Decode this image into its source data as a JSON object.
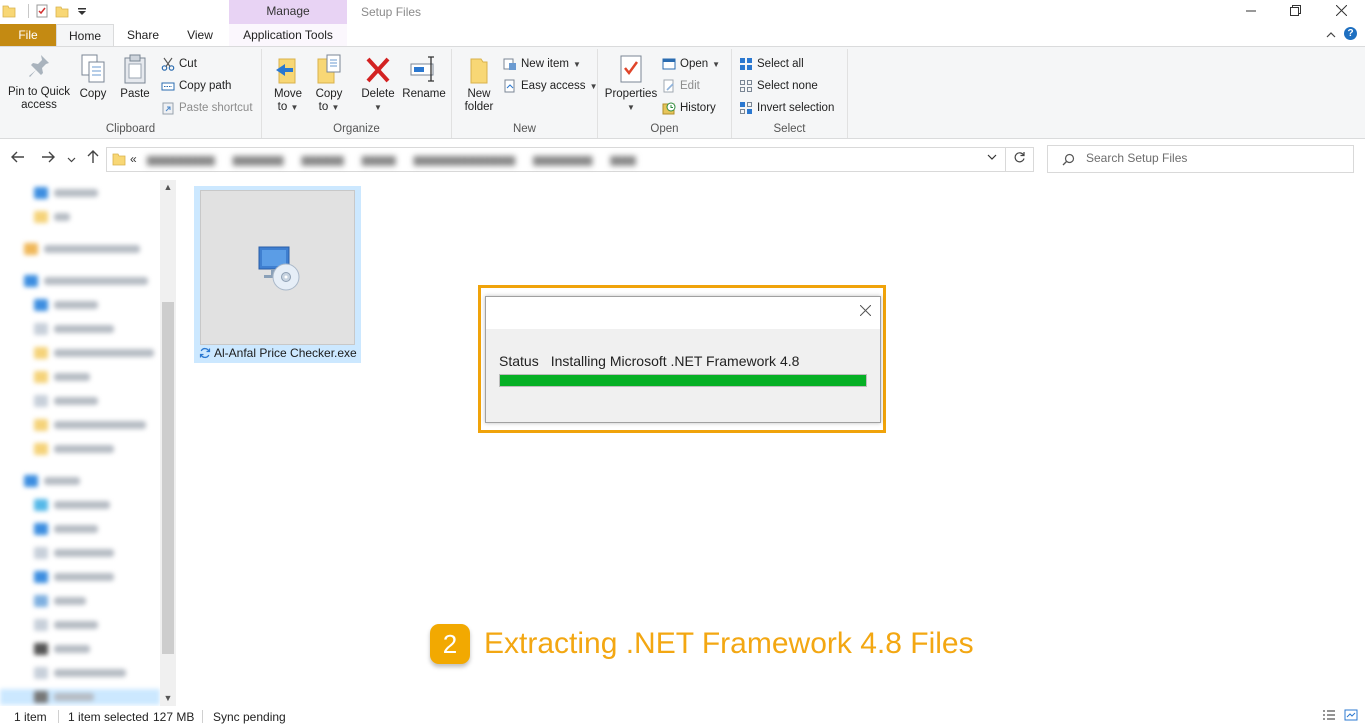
{
  "window": {
    "title": "Setup Files",
    "contextual_tab_group": "Manage",
    "controls": [
      "minimize",
      "maximize",
      "close"
    ]
  },
  "ribbon_tabs": {
    "file": "File",
    "home": "Home",
    "share": "Share",
    "view": "View",
    "application_tools": "Application Tools"
  },
  "ribbon": {
    "clipboard": {
      "label": "Clipboard",
      "pin_line1": "Pin to Quick",
      "pin_line2": "access",
      "copy": "Copy",
      "paste": "Paste",
      "cut": "Cut",
      "copy_path": "Copy path",
      "paste_shortcut": "Paste shortcut"
    },
    "organize": {
      "label": "Organize",
      "move_line1": "Move",
      "move_line2": "to",
      "copy_line1": "Copy",
      "copy_line2": "to",
      "delete": "Delete",
      "rename": "Rename"
    },
    "new": {
      "label": "New",
      "new_folder_line1": "New",
      "new_folder_line2": "folder",
      "new_item": "New item",
      "easy_access": "Easy access"
    },
    "open": {
      "label": "Open",
      "properties": "Properties",
      "open": "Open",
      "edit": "Edit",
      "history": "History"
    },
    "select": {
      "label": "Select",
      "select_all": "Select all",
      "select_none": "Select none",
      "invert_selection": "Invert selection"
    }
  },
  "address_bar": {
    "overflow": "«",
    "search_placeholder": "Search Setup Files"
  },
  "content": {
    "file": {
      "name": "Al-Anfal Price Checker.exe",
      "icon": "installer-disc-icon",
      "sync_icon": "sync-pending-icon"
    }
  },
  "dialog": {
    "status_label": "Status",
    "status_text": "Installing Microsoft .NET Framework 4.8",
    "progress_fraction": 1.0,
    "progress_color": "#06b025"
  },
  "caption": {
    "step_number": "2",
    "text": "Extracting .NET Framework 4.8 Files",
    "color": "#f3a712",
    "badge_color": "#f2a901"
  },
  "status_bar": {
    "item_count": "1 item",
    "selection": "1 item selected",
    "size": "127 MB",
    "sync": "Sync pending"
  },
  "colors": {
    "file_tab": "#c48a12",
    "manage_tab": "#e8d3f4",
    "highlight_border": "#f0a30a",
    "selection": "#cce8ff"
  }
}
